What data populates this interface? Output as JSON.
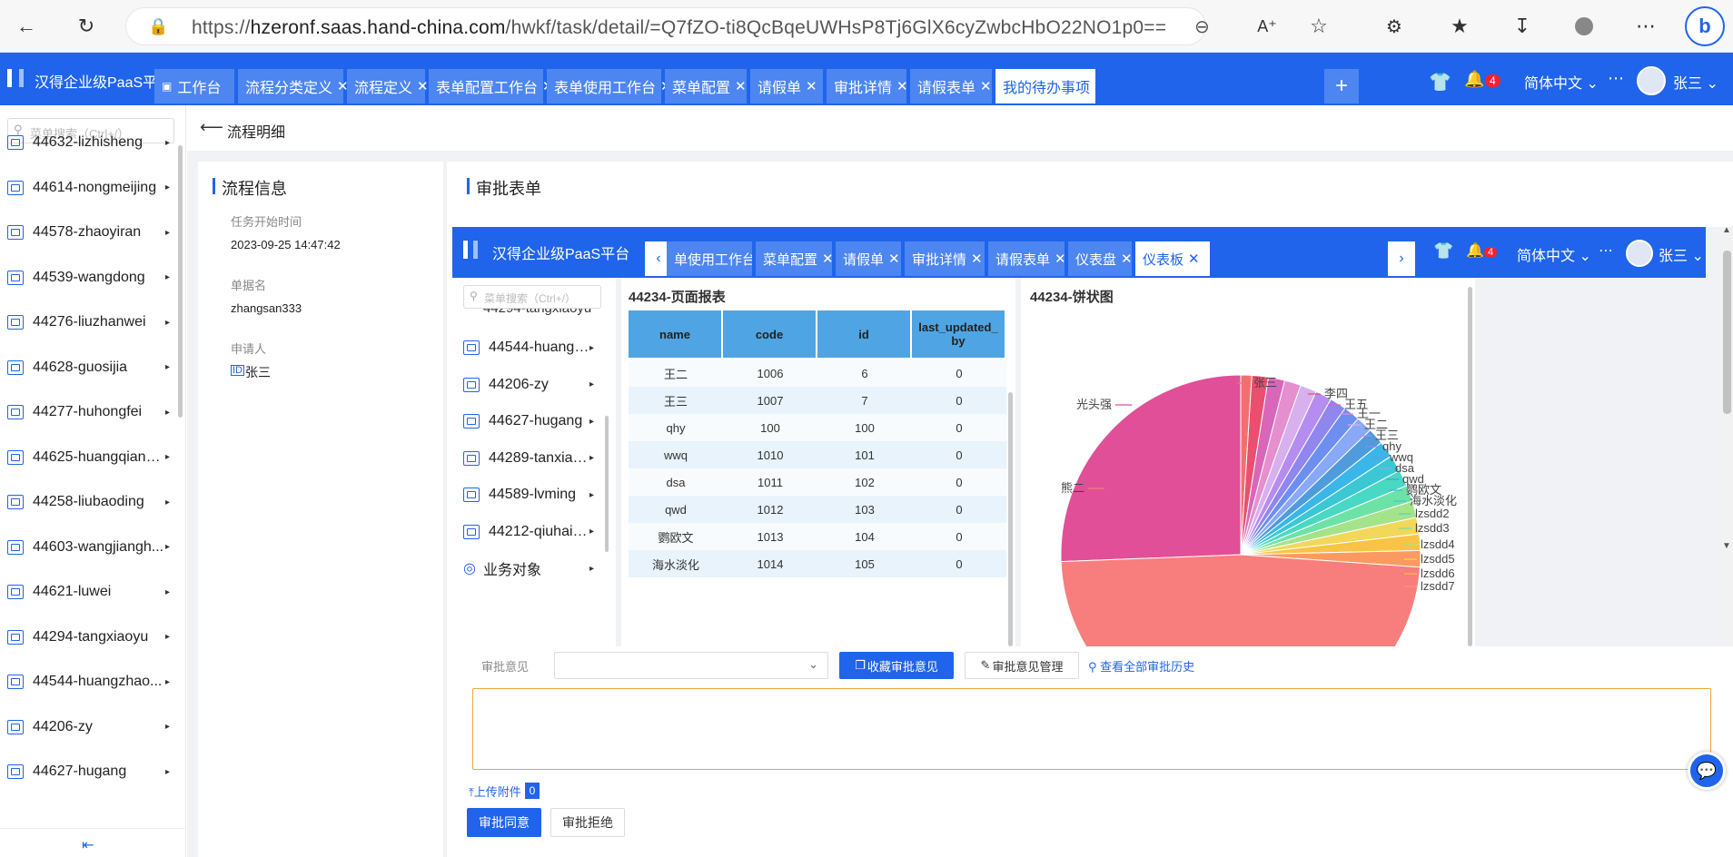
{
  "browser": {
    "url_prefix": "https://",
    "url_host": "hzeronf.saas.hand-china.com",
    "url_path": "/hwkf/task/detail/=Q7fZO-ti8QcBqeUWHsP8Tj6GlX6cyZwbcHbO22NO1p0=="
  },
  "app": {
    "brand": "汉得企业级PaaS平台",
    "tabs": [
      {
        "label": "工作台",
        "closable": false,
        "icon": "dashboard-icon"
      },
      {
        "label": "流程分类定义",
        "closable": true
      },
      {
        "label": "流程定义",
        "closable": true
      },
      {
        "label": "表单配置工作台",
        "closable": true
      },
      {
        "label": "表单使用工作台",
        "closable": true
      },
      {
        "label": "菜单配置",
        "closable": true
      },
      {
        "label": "请假单",
        "closable": true
      },
      {
        "label": "审批详情",
        "closable": true
      },
      {
        "label": "请假表单",
        "closable": true
      },
      {
        "label": "我的待办事项",
        "closable": true,
        "active": true
      }
    ],
    "notif_count": "4",
    "language": "简体中文",
    "user": "张三"
  },
  "sidebar": {
    "search_placeholder": "菜单搜索（Ctrl+/）",
    "items": [
      "44632-lizhisheng",
      "44614-nongmeijing",
      "44578-zhaoyiran",
      "44539-wangdong",
      "44276-liuzhanwei",
      "44628-guosijia",
      "44277-huhongfei",
      "44625-huangqiang...",
      "44258-liubaoding",
      "44603-wangjiangh...",
      "44621-luwei",
      "44294-tangxiaoyu",
      "44544-huangzhao...",
      "44206-zy",
      "44627-hugang"
    ]
  },
  "breadcrumb": {
    "back_label": "流程明细"
  },
  "process_info": {
    "title": "流程信息",
    "start_label": "任务开始时间",
    "start_value": "2023-09-25 14:47:42",
    "docname_label": "单据名",
    "docname_value": "zhangsan333",
    "applicant_label": "申请人",
    "applicant_value": "张三"
  },
  "approval_form": {
    "title": "审批表单"
  },
  "embedded": {
    "brand": "汉得企业级PaaS平台",
    "tabs": [
      {
        "label": "单使用工作台"
      },
      {
        "label": "菜单配置"
      },
      {
        "label": "请假单"
      },
      {
        "label": "审批详情"
      },
      {
        "label": "请假表单"
      },
      {
        "label": "仪表盘"
      },
      {
        "label": "仪表板",
        "active": true
      }
    ],
    "notif_count": "4",
    "language": "简体中文",
    "user": "张三",
    "search_placeholder": "菜单搜索（Ctrl+/）",
    "nav_partial": "44294-tangxiaoyu",
    "nav_items": [
      "44544-huangzhao...",
      "44206-zy",
      "44627-hugang",
      "44289-tanxiaolong",
      "44589-lvming",
      "44212-qiuhaiyang"
    ],
    "nav_business": "业务对象",
    "report": {
      "title": "44234-页面报表",
      "columns": [
        "name",
        "code",
        "id",
        "last_updated_by"
      ],
      "rows": [
        [
          "王二",
          "1006",
          "6",
          "0"
        ],
        [
          "王三",
          "1007",
          "7",
          "0"
        ],
        [
          "qhy",
          "100",
          "100",
          "0"
        ],
        [
          "wwq",
          "1010",
          "101",
          "0"
        ],
        [
          "dsa",
          "1011",
          "102",
          "0"
        ],
        [
          "qwd",
          "1012",
          "103",
          "0"
        ],
        [
          "鹦欧文",
          "1013",
          "104",
          "0"
        ],
        [
          "海水淡化",
          "1014",
          "105",
          "0"
        ]
      ]
    },
    "pie": {
      "title": "44234-饼状图",
      "labels": [
        "光头强",
        "张三",
        "李四",
        "王五",
        "王一",
        "王二",
        "王三",
        "qhy",
        "wwq",
        "dsa",
        "qwd",
        "鹦欧文",
        "海水淡化",
        "lzsdd2",
        "lzsdd3",
        "lzsdd4",
        "lzsdd5",
        "lzsdd6",
        "lzsdd7",
        "熊二"
      ],
      "colors": [
        "#e04f97",
        "#f36f6f",
        "#e94f6e",
        "#d966b8",
        "#e58fcf",
        "#d8b0ee",
        "#b58df0",
        "#8f86ee",
        "#6d8ff0",
        "#89a8f6",
        "#4f9bdc",
        "#3ab7e8",
        "#3cc7d5",
        "#49d8c3",
        "#6de2a7",
        "#a5e38a",
        "#f2d75a",
        "#f9c445",
        "#fa9a60",
        "#f87d7d"
      ]
    }
  },
  "opinion": {
    "label": "审批意见",
    "collect_btn": "收藏审批意见",
    "manage_btn": "审批意见管理",
    "history_link": "查看全部审批历史",
    "upload_label": "上传附件",
    "upload_count": "0",
    "approve_btn": "审批同意",
    "reject_btn": "审批拒绝"
  }
}
